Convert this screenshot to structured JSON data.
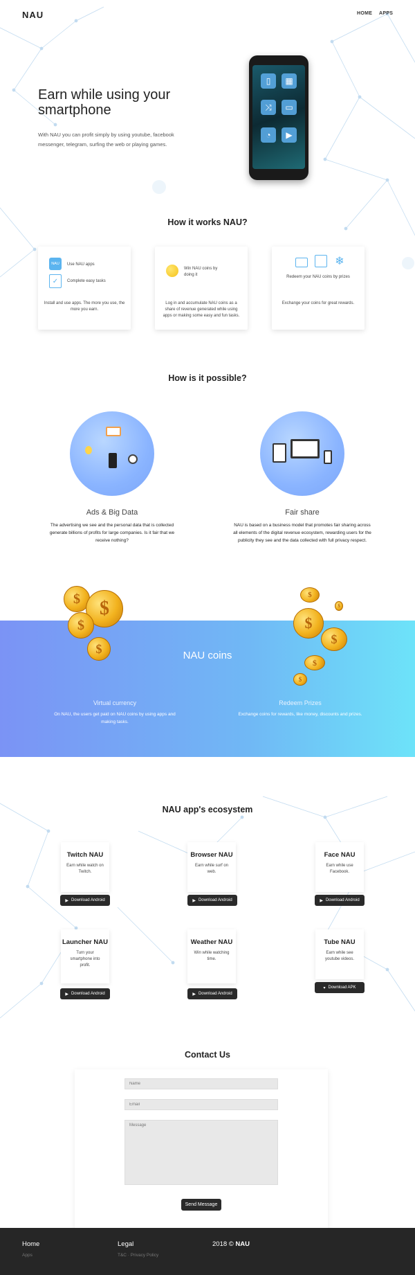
{
  "header": {
    "logo": "NAU",
    "nav": [
      "HOME",
      "APPS"
    ]
  },
  "hero": {
    "title": "Earn while using your smartphone",
    "subtitle": "With NAU you can profit simply by using youtube, facebook messenger, telegram, surfing the web or playing games."
  },
  "how_it_works": {
    "title": "How it works NAU?",
    "cards": [
      {
        "items": [
          "Use NAU apps",
          "Complete easy tasks"
        ],
        "icon_label": "NAU",
        "text": "Install and use apps. The more you use, the more you earn."
      },
      {
        "items": [
          "Win NAU coins by doing it"
        ],
        "text": "Log in and accumulate NAU coins as a share of revenue generated while using apps or making some easy and fun tasks."
      },
      {
        "items": [
          "Redeem your NAU coins by prizes"
        ],
        "text": "Exchange your coins for great rewards."
      }
    ]
  },
  "possible": {
    "title": "How is it possible?",
    "left": {
      "title": "Ads & Big Data",
      "text": "The advertising we see and the personal data that is collected generate billions of profits for large companies. Is it fair that we receive nothing?"
    },
    "right": {
      "title": "Fair share",
      "text": "NAU is based on a business model that promotes fair sharing across all elements of the digital revenue ecosystem, rewarding users for the publicity they see and the data collected with full privacy respect."
    }
  },
  "coins": {
    "title": "NAU coins",
    "left": {
      "title": "Virtual currency",
      "text": "On NAU, the users get paid on NAU coins by using apps and making tasks."
    },
    "right": {
      "title": "Redeem Prizes",
      "text": "Exchange coins for rewards, like money, discounts and prizes."
    }
  },
  "ecosystem": {
    "title": "NAU app's ecosystem",
    "apps": [
      {
        "name": "Twitch NAU",
        "desc": "Earn while watch on Twitch.",
        "button": "Download Android"
      },
      {
        "name": "Browser NAU",
        "desc": "Earn while surf on web.",
        "button": "Download Android"
      },
      {
        "name": "Face NAU",
        "desc": "Earn while use Facebook.",
        "button": "Download Android"
      },
      {
        "name": "Launcher NAU",
        "desc": "Turn your smartphone into profit.",
        "button": "Download Android"
      },
      {
        "name": "Weather NAU",
        "desc": "Win while watching time.",
        "button": "Download Android"
      },
      {
        "name": "Tube NAU",
        "desc": "Earn while see youtube videos.",
        "button": "Download APK"
      }
    ]
  },
  "contact": {
    "title": "Contact Us",
    "name_placeholder": "Name",
    "email_placeholder": "Email",
    "message_placeholder": "Message",
    "send": "Send Message"
  },
  "footer": {
    "col1_title": "Home",
    "col1_link": "Apps",
    "col2_title": "Legal",
    "col2_link": "T&C · Privacy Policy",
    "copyright": "2018 ©",
    "brand": "NAU"
  },
  "colors": {
    "band_start": "#7b93f5",
    "band_end": "#6de3f9",
    "button": "#2a2a2a",
    "footer": "#262626"
  }
}
